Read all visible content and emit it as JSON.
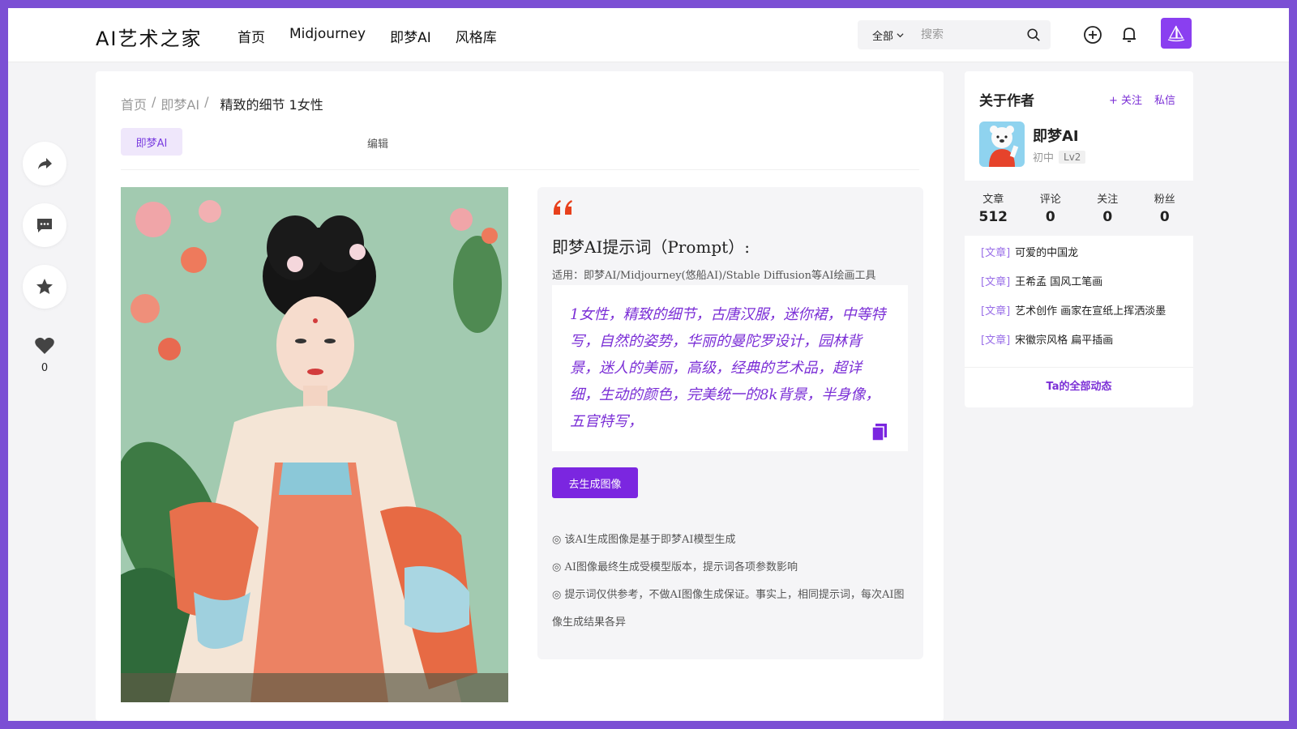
{
  "header": {
    "logo": "AI艺术之家",
    "nav": [
      "首页",
      "Midjourney",
      "即梦AI",
      "风格库"
    ],
    "search_scope": "全部",
    "search_placeholder": "搜索"
  },
  "side_actions": {
    "like_count": "0"
  },
  "breadcrumb": {
    "home": "首页",
    "sep1": "/",
    "category": "即梦AI",
    "sep2": "/",
    "current": "精致的细节 1女性"
  },
  "tag_chip": "即梦AI",
  "edit_label": "编辑",
  "prompt": {
    "title": "即梦AI提示词（Prompt）:",
    "subtitle": "适用：即梦AI/Midjourney(悠船AI)/Stable Diffusion等AI绘画工具",
    "text": "1女性，精致的细节，古唐汉服，迷你裙，中等特写，自然的姿势，华丽的曼陀罗设计，园林背景，迷人的美丽，高级，经典的艺术品，超详细，生动的颜色，完美统一的8k背景，半身像，五官特写，",
    "generate_button": "去生成图像",
    "notes": [
      "◎ 该AI生成图像是基于即梦AI模型生成",
      "◎ AI图像最终生成受模型版本，提示词各项参数影响",
      "◎ 提示词仅供参考，不做AI图像生成保证。事实上，相同提示词，每次AI图像生成结果各异"
    ]
  },
  "author": {
    "section_title": "关于作者",
    "follow": "+ 关注",
    "message": "私信",
    "name": "即梦AI",
    "level_text": "初中",
    "level_badge": "Lv2",
    "stats": [
      {
        "label": "文章",
        "value": "512"
      },
      {
        "label": "评论",
        "value": "0"
      },
      {
        "label": "关注",
        "value": "0"
      },
      {
        "label": "粉丝",
        "value": "0"
      }
    ],
    "posts": [
      {
        "tag": "[文章]",
        "title": "可爱的中国龙"
      },
      {
        "tag": "[文章]",
        "title": "王希孟 国风工笔画"
      },
      {
        "tag": "[文章]",
        "title": "艺术创作 画家在宣纸上挥洒淡墨"
      },
      {
        "tag": "[文章]",
        "title": "宋徽宗风格 扁平插画"
      }
    ],
    "all_activity": "Ta的全部动态"
  },
  "colors": {
    "accent": "#7b26e0",
    "frame": "#7b4fd4",
    "quote": "#e8401c"
  }
}
